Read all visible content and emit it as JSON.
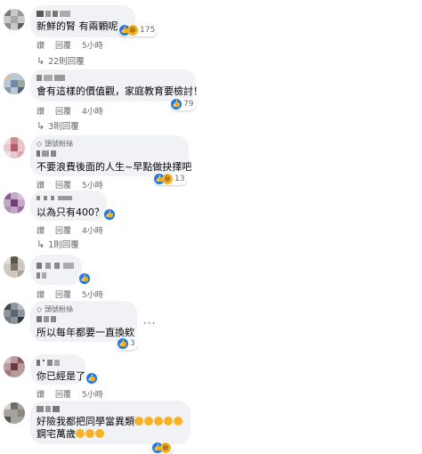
{
  "comments": [
    {
      "text": "新鮮的腎 有兩顆呢",
      "reactions": "175",
      "actions": {
        "like": "讚",
        "reply": "回覆",
        "time": "5小時"
      },
      "replies": "22則回覆"
    },
    {
      "text": "會有這樣的價值觀，家庭教育要檢討！",
      "reactions": "79",
      "actions": {
        "like": "讚",
        "reply": "回覆",
        "time": "4小時"
      },
      "replies": "3則回覆"
    },
    {
      "badge": "頭號粉絲",
      "text": "不要浪費後面的人生~早點做抉擇吧",
      "reactions": "13",
      "actions": {
        "like": "讚",
        "reply": "回覆",
        "time": "5小時"
      }
    },
    {
      "text": "以為只有400？",
      "actions": {
        "like": "讚",
        "reply": "回覆",
        "time": "4小時"
      },
      "replies": "1則回覆"
    },
    {
      "actions": {
        "like": "讚",
        "reply": "回覆",
        "time": "5小時"
      }
    },
    {
      "badge": "頭號粉絲",
      "text": "所以每年都要一直換欸",
      "reactions": "3",
      "actions": {
        "like": "讚",
        "reply": "回覆",
        "time": "5小時"
      }
    },
    {
      "text": "你已經是了",
      "actions": {
        "like": "讚",
        "reply": "回覆",
        "time": "5小時"
      }
    },
    {
      "text": "好險我都把同學當異類",
      "text2": "鋼宅萬歲"
    }
  ],
  "icons": {
    "like": "like-icon",
    "haha": "haha-icon",
    "reply_arrow": "reply-arrow-icon",
    "more": "more-options-icon",
    "badge": "diamond-badge-icon"
  },
  "colors": {
    "like_blue": "#1877f2",
    "bubble_bg": "#f0f2f5",
    "secondary_text": "#65676b"
  }
}
